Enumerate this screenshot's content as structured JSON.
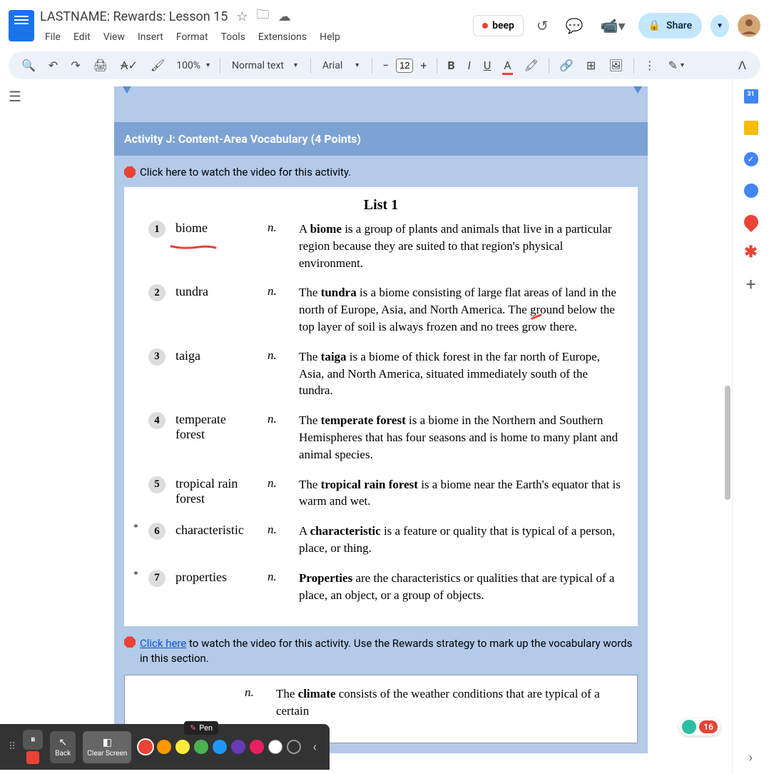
{
  "header": {
    "title": "LASTNAME: Rewards: Lesson 15",
    "menus": [
      "File",
      "Edit",
      "View",
      "Insert",
      "Format",
      "Tools",
      "Extensions",
      "Help"
    ],
    "beep_label": "beep",
    "share_label": "Share"
  },
  "toolbar": {
    "zoom": "100%",
    "style": "Normal text",
    "font": "Arial",
    "font_size": "12"
  },
  "doc": {
    "activity_header": "Activity J: Content-Area Vocabulary (4 Points)",
    "instruction_1": "Click here to watch the video for this activity.",
    "list_title": "List 1",
    "vocab": [
      {
        "num": "1",
        "star": "",
        "term": "biome",
        "pos": "n.",
        "bold": "biome",
        "def_pre": "A ",
        "def_post": " is a group of plants and animals that live in a particular region because they are suited to that region's physical environment."
      },
      {
        "num": "2",
        "star": "",
        "term": "tundra",
        "pos": "n.",
        "bold": "tundra",
        "def_pre": "The ",
        "def_post": " is a biome consisting of large flat areas of land in the north of Europe, Asia, and North America. The ground below the top layer of soil is always frozen and no trees grow there."
      },
      {
        "num": "3",
        "star": "",
        "term": "taiga",
        "pos": "n.",
        "bold": "taiga",
        "def_pre": "The ",
        "def_post": " is a biome of thick forest in the far north of Europe, Asia, and North America, situated immediately south of the tundra."
      },
      {
        "num": "4",
        "star": "",
        "term": "temperate forest",
        "pos": "n.",
        "bold": "temperate forest",
        "def_pre": "The ",
        "def_post": " is a biome in the Northern and Southern Hemispheres that has four seasons and is home to many plant and animal species."
      },
      {
        "num": "5",
        "star": "",
        "term": "tropical rain forest",
        "pos": "n.",
        "bold": "tropical rain forest",
        "def_pre": "The ",
        "def_post": " is a biome near the Earth's equator that is warm and wet."
      },
      {
        "num": "6",
        "star": "*",
        "term": "characteristic",
        "pos": "n.",
        "bold": "characteristic",
        "def_pre": "A ",
        "def_post": " is a feature or quality that is typical of a person, place, or thing."
      },
      {
        "num": "7",
        "star": "*",
        "term": "properties",
        "pos": "n.",
        "bold": "Properties",
        "def_pre": "",
        "def_post": " are the characteristics or qualities that are typical of a place, an object, or a group of objects."
      }
    ],
    "instruction_2_link": "Click here",
    "instruction_2_rest": " to watch the video for this activity. Use the Rewards strategy to mark up the vocabulary words in this section.",
    "vocab2": {
      "pos": "n.",
      "bold": "climate",
      "def_pre": "The ",
      "def_post": " consists of the weather conditions that are typical of a certain"
    }
  },
  "annotate": {
    "back": "Back",
    "clear": "Clear Screen",
    "pen": "Pen",
    "colors": [
      "#ea4335",
      "#ff9800",
      "#ffeb3b",
      "#4caf50",
      "#2196f3",
      "#673ab7",
      "#e91e63",
      "#ffffff",
      "#9e9e9e"
    ]
  },
  "badge": {
    "count": "16"
  }
}
